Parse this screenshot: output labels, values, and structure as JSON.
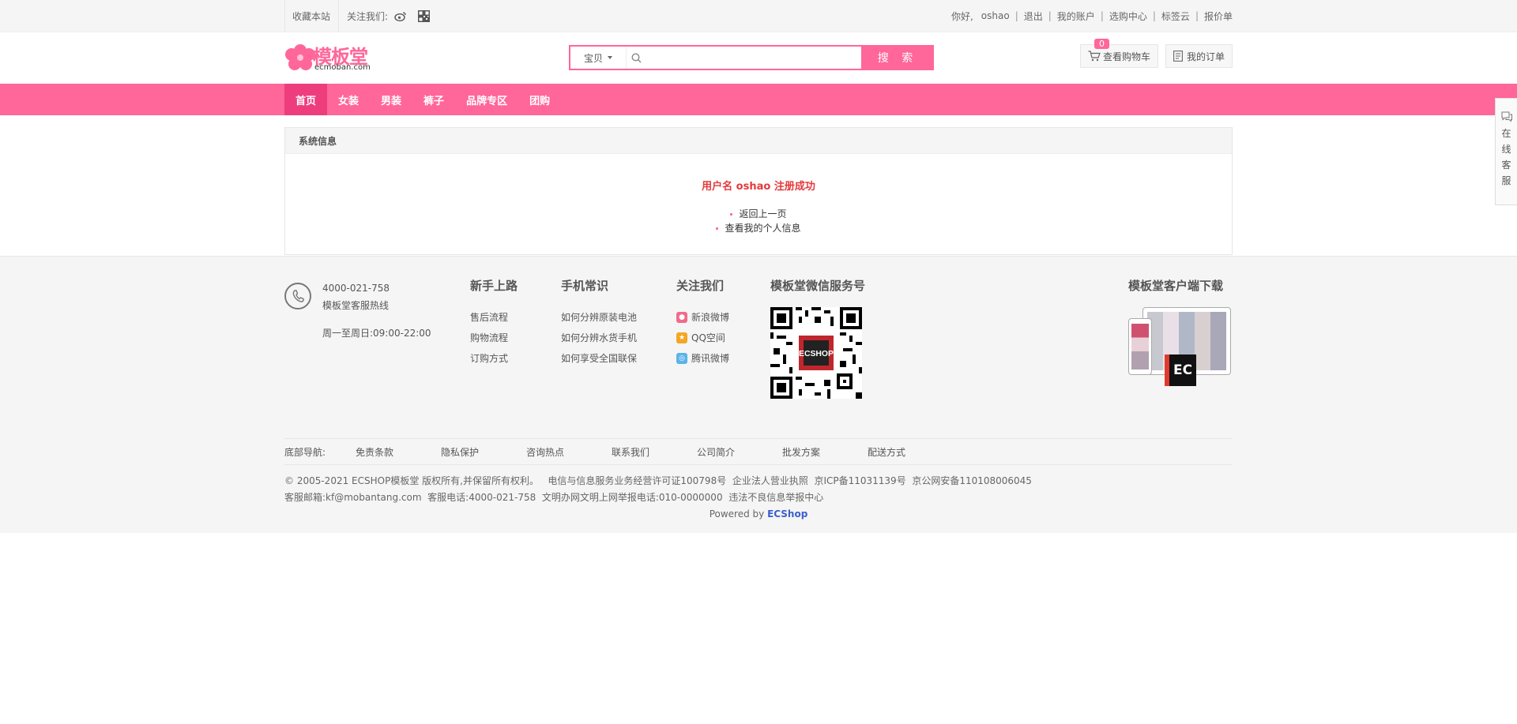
{
  "topbar": {
    "bookmark": "收藏本站",
    "follow": "关注我们:",
    "greeting": "你好,",
    "username": "oshao",
    "links": [
      "退出",
      "我的账户",
      "选购中心",
      "标签云",
      "报价单"
    ]
  },
  "header": {
    "logo_text": "模板堂",
    "logo_sub": "ecmoban.com",
    "search": {
      "category": "宝贝",
      "placeholder": "",
      "button": "搜 索"
    },
    "cart": {
      "label": "查看购物车",
      "count": "0"
    },
    "orders": {
      "label": "我的订单"
    }
  },
  "nav": {
    "items": [
      "首页",
      "女装",
      "男装",
      "裤子",
      "品牌专区",
      "团购"
    ]
  },
  "content": {
    "title": "系统信息",
    "message": "用户名 oshao 注册成功",
    "links": [
      "返回上一页",
      "查看我的个人信息"
    ]
  },
  "footer": {
    "hotline": {
      "phone": "4000-021-758",
      "label": "模板堂客服热线",
      "hours": "周一至周日:09:00-22:00"
    },
    "columns": [
      {
        "title": "新手上路",
        "links": [
          "售后流程",
          "购物流程",
          "订购方式"
        ]
      },
      {
        "title": "手机常识",
        "links": [
          "如何分辨原装电池",
          "如何分辨水货手机",
          "如何享受全国联保"
        ]
      }
    ],
    "follow": {
      "title": "关注我们",
      "links": [
        "新浪微博",
        "QQ空间",
        "腾讯微博"
      ]
    },
    "wechat": {
      "title": "模板堂微信服务号"
    },
    "client": {
      "title": "模板堂客户端下载",
      "badge": "EC"
    },
    "bottom_nav": {
      "label": "底部导航:",
      "items": [
        "免责条款",
        "隐私保护",
        "咨询热点",
        "联系我们",
        "公司简介",
        "批发方案",
        "配送方式"
      ]
    },
    "copyright_line1": "© 2005-2021 ECSHOP模板堂 版权所有,并保留所有权利。   电信与信息服务业务经营许可证100798号  企业法人营业执照  京ICP备11031139号  京公网安备110108006045",
    "copyright_line2": "客服邮箱:kf@mobantang.com  客服电话:4000-021-758  文明办网文明上网举报电话:010-0000000  违法不良信息举报中心",
    "powered_prefix": "Powered by ",
    "powered_brand": "ECShop"
  },
  "side_service": {
    "chars": [
      "在",
      "线",
      "客",
      "服"
    ]
  },
  "colors": {
    "accent": "#ff6699",
    "nav_active": "#ee3d7d",
    "success": "#e4393c"
  }
}
